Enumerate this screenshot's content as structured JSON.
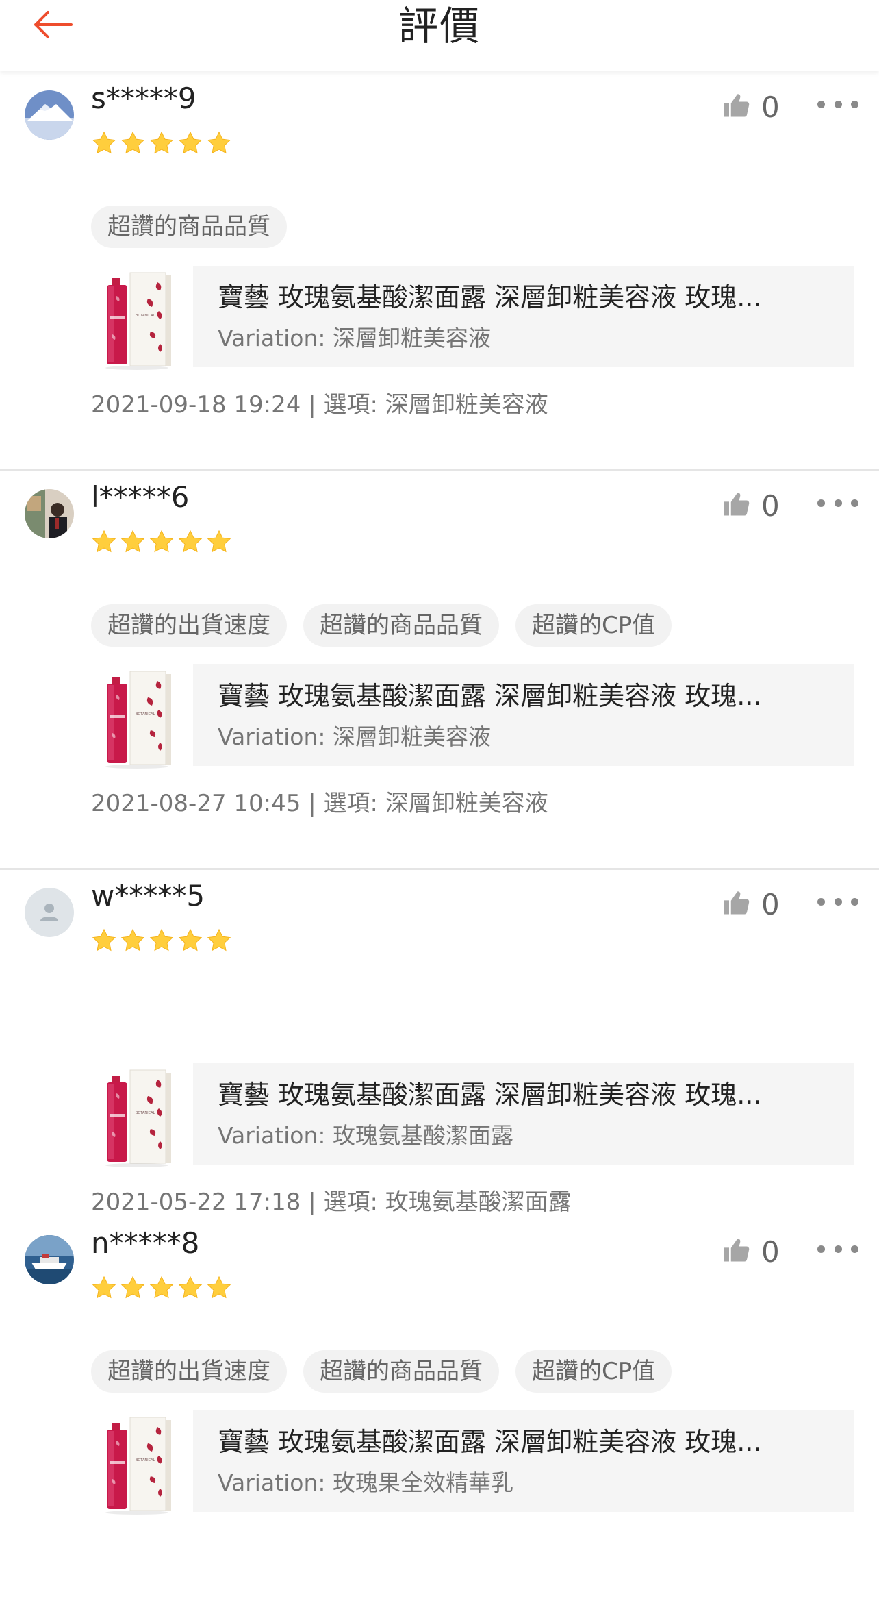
{
  "header": {
    "title": "評價"
  },
  "reviews": [
    {
      "username": "s*****9",
      "avatar": "mountain-photo",
      "rating": 5,
      "likes": "0",
      "tags": [
        "超讚的商品品質"
      ],
      "product_name": "寶藝 玫瑰氨基酸潔面露 深層卸粧美容液 玫瑰...",
      "variation": "Variation: 深層卸粧美容液",
      "meta": "2021-09-18 19:24 | 選項: 深層卸粧美容液"
    },
    {
      "username": "l*****6",
      "avatar": "people-photo",
      "rating": 5,
      "likes": "0",
      "tags": [
        "超讚的出貨速度",
        "超讚的商品品質",
        "超讚的CP值"
      ],
      "product_name": "寶藝 玫瑰氨基酸潔面露 深層卸粧美容液 玫瑰...",
      "variation": "Variation: 深層卸粧美容液",
      "meta": "2021-08-27 10:45 | 選項: 深層卸粧美容液"
    },
    {
      "username": "w*****5",
      "avatar": "default-user",
      "rating": 5,
      "likes": "0",
      "tags": [],
      "product_name": "寶藝 玫瑰氨基酸潔面露 深層卸粧美容液 玫瑰...",
      "variation": "Variation: 玫瑰氨基酸潔面露",
      "meta": "2021-05-22 17:18 | 選項: 玫瑰氨基酸潔面露"
    },
    {
      "username": "n*****8",
      "avatar": "boat-photo",
      "rating": 5,
      "likes": "0",
      "tags": [
        "超讚的出貨速度",
        "超讚的商品品質",
        "超讚的CP值"
      ],
      "product_name": "寶藝 玫瑰氨基酸潔面露 深層卸粧美容液 玫瑰...",
      "variation": "Variation: 玫瑰果全效精華乳",
      "meta": ""
    }
  ],
  "colors": {
    "accent": "#ee4d2d",
    "star": "#ffce3d",
    "divider": "#e5e5e5",
    "tag_bg": "#f2f2f2",
    "product_bg": "#f5f5f5"
  }
}
